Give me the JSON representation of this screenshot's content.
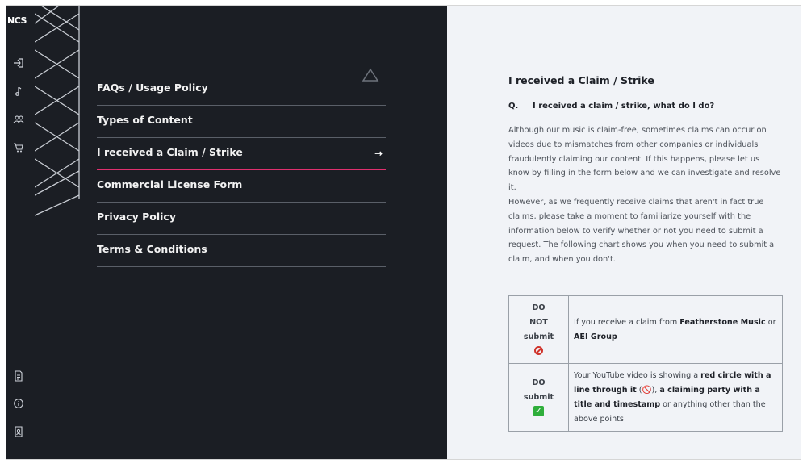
{
  "sidebar": {
    "logo": "NCS",
    "top_icons": [
      "sign-in-icon",
      "music-note-icon",
      "users-icon",
      "cart-icon"
    ],
    "bottom_icons": [
      "document-icon",
      "info-icon",
      "id-card-icon"
    ]
  },
  "menu": {
    "items": [
      {
        "label": "FAQs / Usage Policy"
      },
      {
        "label": "Types of Content"
      },
      {
        "label": "I received a Claim / Strike",
        "active": true
      },
      {
        "label": "Commercial License Form"
      },
      {
        "label": "Privacy Policy"
      },
      {
        "label": "Terms & Conditions"
      }
    ],
    "active_arrow": "→"
  },
  "content": {
    "title": "I received a Claim / Strike",
    "q_marker": "Q.",
    "question": "I received a claim / strike, what do I do?",
    "paragraph1": "Although our music is claim-free, sometimes claims can occur on videos due to mismatches from other companies or individuals fraudulently claiming our content. If this happens, please let us know by filling in the form below and we can investigate and resolve it.",
    "paragraph2": "However, as we frequently receive claims that aren't in fact true claims, please take a moment to familiarize yourself with the information below to verify whether or not you need to submit a request. The following chart shows you when you need to submit a claim, and when you don't."
  },
  "chart_table": {
    "rows": [
      {
        "status_line1": "DO",
        "status_line2": "NOT",
        "status_line3": "submit",
        "icon": "no-entry-icon",
        "desc_pre": "If you receive a claim from ",
        "desc_b1": "Featherstone Music",
        "desc_mid": " or ",
        "desc_b2": "AEI Group"
      },
      {
        "status_line1": "DO",
        "status_line2": "submit",
        "icon": "check-mark-icon",
        "desc_pre": "Your YouTube video is showing a ",
        "desc_b1": "red circle with a line through it",
        "desc_mid": " (🚫), ",
        "desc_b2": "a claiming party with a title and timestamp",
        "desc_post": " or anything other than the above points"
      }
    ]
  },
  "colors": {
    "dark_bg": "#1b1e24",
    "content_bg": "#f1f3f7",
    "accent": "#e0306f"
  }
}
